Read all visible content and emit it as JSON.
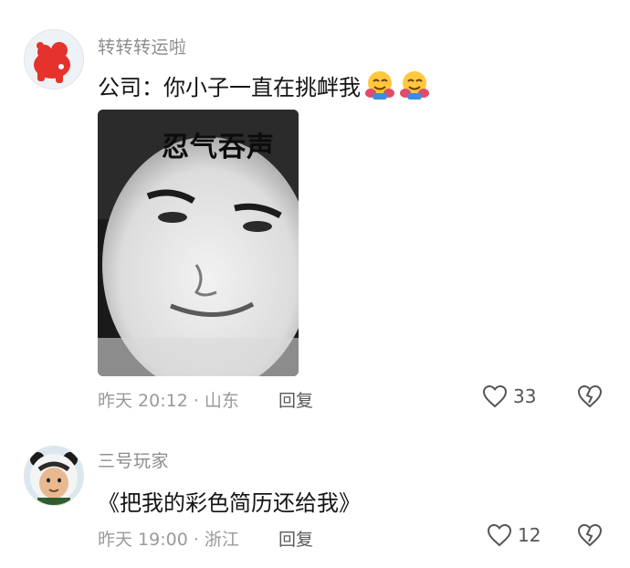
{
  "comments": [
    {
      "username": "转转转运啦",
      "text": "公司：你小子一直在挑衅我",
      "emojis": [
        "hugging-face-emoji",
        "hugging-face-emoji"
      ],
      "image_caption": "忍气吞声",
      "meta": "昨天 20:12 · 山东",
      "reply_label": "回复",
      "likes": "33"
    },
    {
      "username": "三号玩家",
      "text": "《把我的彩色简历还给我》",
      "meta": "昨天 19:00 · 浙江",
      "reply_label": "回复",
      "likes": "12"
    }
  ],
  "colors": {
    "background": "#ffffff",
    "username": "#8d8d8d",
    "meta": "#9a9a9a",
    "text": "#141414"
  }
}
